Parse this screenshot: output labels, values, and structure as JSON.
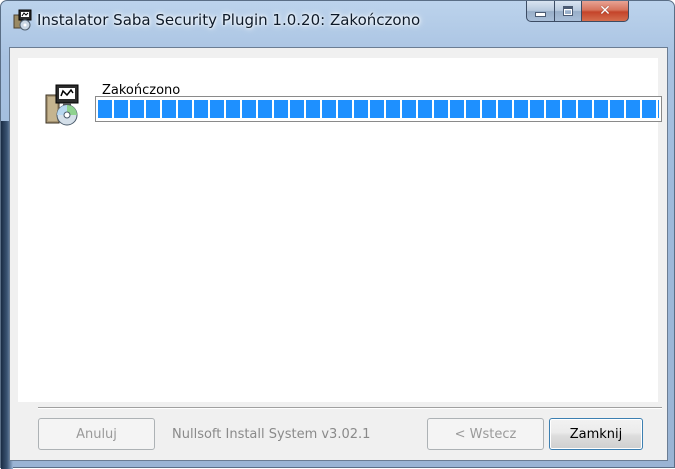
{
  "window": {
    "title": "Instalator Saba Security Plugin 1.0.20: Zakończono",
    "caption_buttons": {
      "minimize_icon": "minimize-icon",
      "maximize_icon": "maximize-icon",
      "close_icon": "close-icon",
      "close_glyph": "✕"
    }
  },
  "main": {
    "status_text": "Zakończono",
    "progress_percent": 100
  },
  "footer": {
    "branding": "Nullsoft Install System v3.02.1",
    "buttons": {
      "cancel": "Anuluj",
      "back": "< Wstecz",
      "close": "Zamknij"
    }
  },
  "colors": {
    "progress": "#1e90ff",
    "close_button": "#c4442a"
  }
}
